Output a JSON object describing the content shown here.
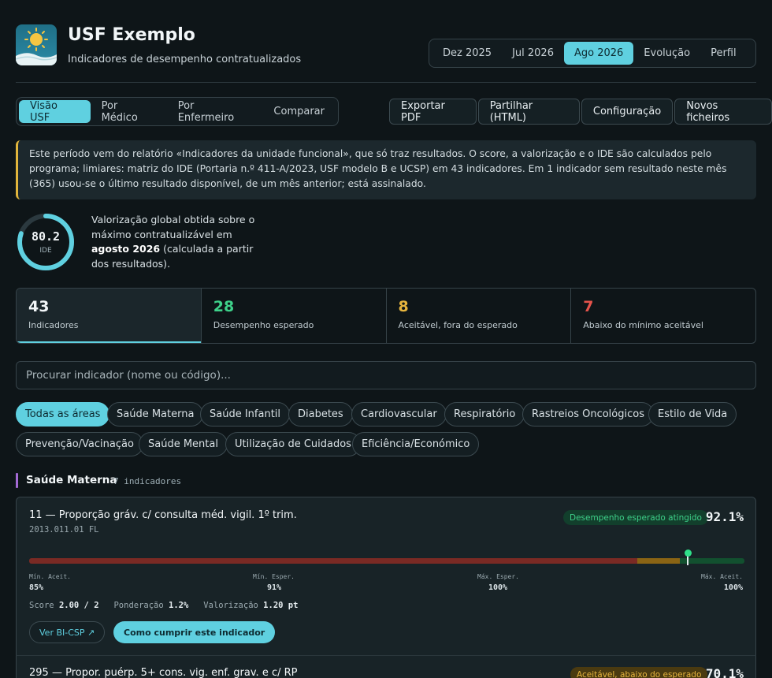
{
  "header": {
    "title": "USF Exemplo",
    "subtitle": "Indicadores de desempenho contratualizados",
    "logo_icon": "sun-landscape-logo"
  },
  "period_tabs": [
    {
      "label": "Dez 2025",
      "active": false
    },
    {
      "label": "Jul 2026",
      "active": false
    },
    {
      "label": "Ago 2026",
      "active": true
    },
    {
      "label": "Evolução",
      "active": false
    },
    {
      "label": "Perfil",
      "active": false
    }
  ],
  "view_tabs": [
    {
      "label": "Visão USF",
      "active": true
    },
    {
      "label": "Por Médico",
      "active": false
    },
    {
      "label": "Por Enfermeiro",
      "active": false
    },
    {
      "label": "Comparar",
      "active": false
    }
  ],
  "actions": {
    "export_pdf": "Exportar PDF",
    "share_html": "Partilhar (HTML)",
    "settings": "Configuração",
    "new_files": "Novos ficheiros"
  },
  "notice": {
    "text": "Este período vem do relatório «Indicadores da unidade funcional», que só traz resultados. O score, a valorização e o IDE são calculados pelo programa; limiares: matriz do IDE (Portaria n.º 411-A/2023, USF modelo B e UCSP) em 43 indicadores. Em 1 indicador sem resultado neste mês (365) usou-se o último resultado disponível, de um mês anterior; está assinalado."
  },
  "ide": {
    "value": "80.2",
    "label": "IDE",
    "fraction": 0.802,
    "desc_1": "Valorização global obtida sobre o máximo contratualizável em ",
    "desc_bold": "agosto 2026",
    "desc_2": " (calculada a partir dos resultados)."
  },
  "stats": [
    {
      "value": "43",
      "label": "Indicadores",
      "color": "#f2f6f8",
      "active": true
    },
    {
      "value": "28",
      "label": "Desempenho esperado",
      "color": "#3ed18a",
      "active": false
    },
    {
      "value": "8",
      "label": "Aceitável, fora do esperado",
      "color": "#e7b53e",
      "active": false
    },
    {
      "value": "7",
      "label": "Abaixo do mínimo aceitável",
      "color": "#e5534b",
      "active": false
    }
  ],
  "search": {
    "placeholder": "Procurar indicador (nome ou código)..."
  },
  "areas": [
    "Todas as áreas",
    "Saúde Materna",
    "Saúde Infantil",
    "Diabetes",
    "Cardiovascular",
    "Respiratório",
    "Rastreios Oncológicos",
    "Estilo de Vida",
    "Prevenção/Vacinação",
    "Saúde Mental",
    "Utilização de Cuidados",
    "Eficiência/Económico"
  ],
  "section": {
    "title": "Saúde Materna",
    "count": "7 indicadores",
    "color": "#a36ad4"
  },
  "indicators": [
    {
      "title": "11 — Proporção gráv. c/ consulta méd. vigil. 1º trim.",
      "code": "2013.011.01 FL",
      "status": "Desempenho esperado atingido",
      "value": "92.1%",
      "result_fraction": 0.921,
      "thresholds": [
        {
          "label": "Mín. Aceit.",
          "value": "85%"
        },
        {
          "label": "Mín. Esper.",
          "value": "91%"
        },
        {
          "label": "Máx. Esper.",
          "value": "100%"
        },
        {
          "label": "Máx. Aceit.",
          "value": "100%"
        }
      ],
      "score_label": "Score",
      "score_value": "2.00 / 2",
      "weight_label": "Ponderação",
      "weight_value": "1.2%",
      "valuation_label": "Valorização",
      "valuation_value": "1.20 pt",
      "bi_link": "Ver BI-CSP ↗",
      "howto": "Como cumprir este indicador"
    },
    {
      "title": "295 — Propor. puérp. 5+ cons. vig. enf. grav. e c/ RP",
      "status": "Aceitável, abaixo do esperado",
      "value": "70.1%"
    }
  ]
}
